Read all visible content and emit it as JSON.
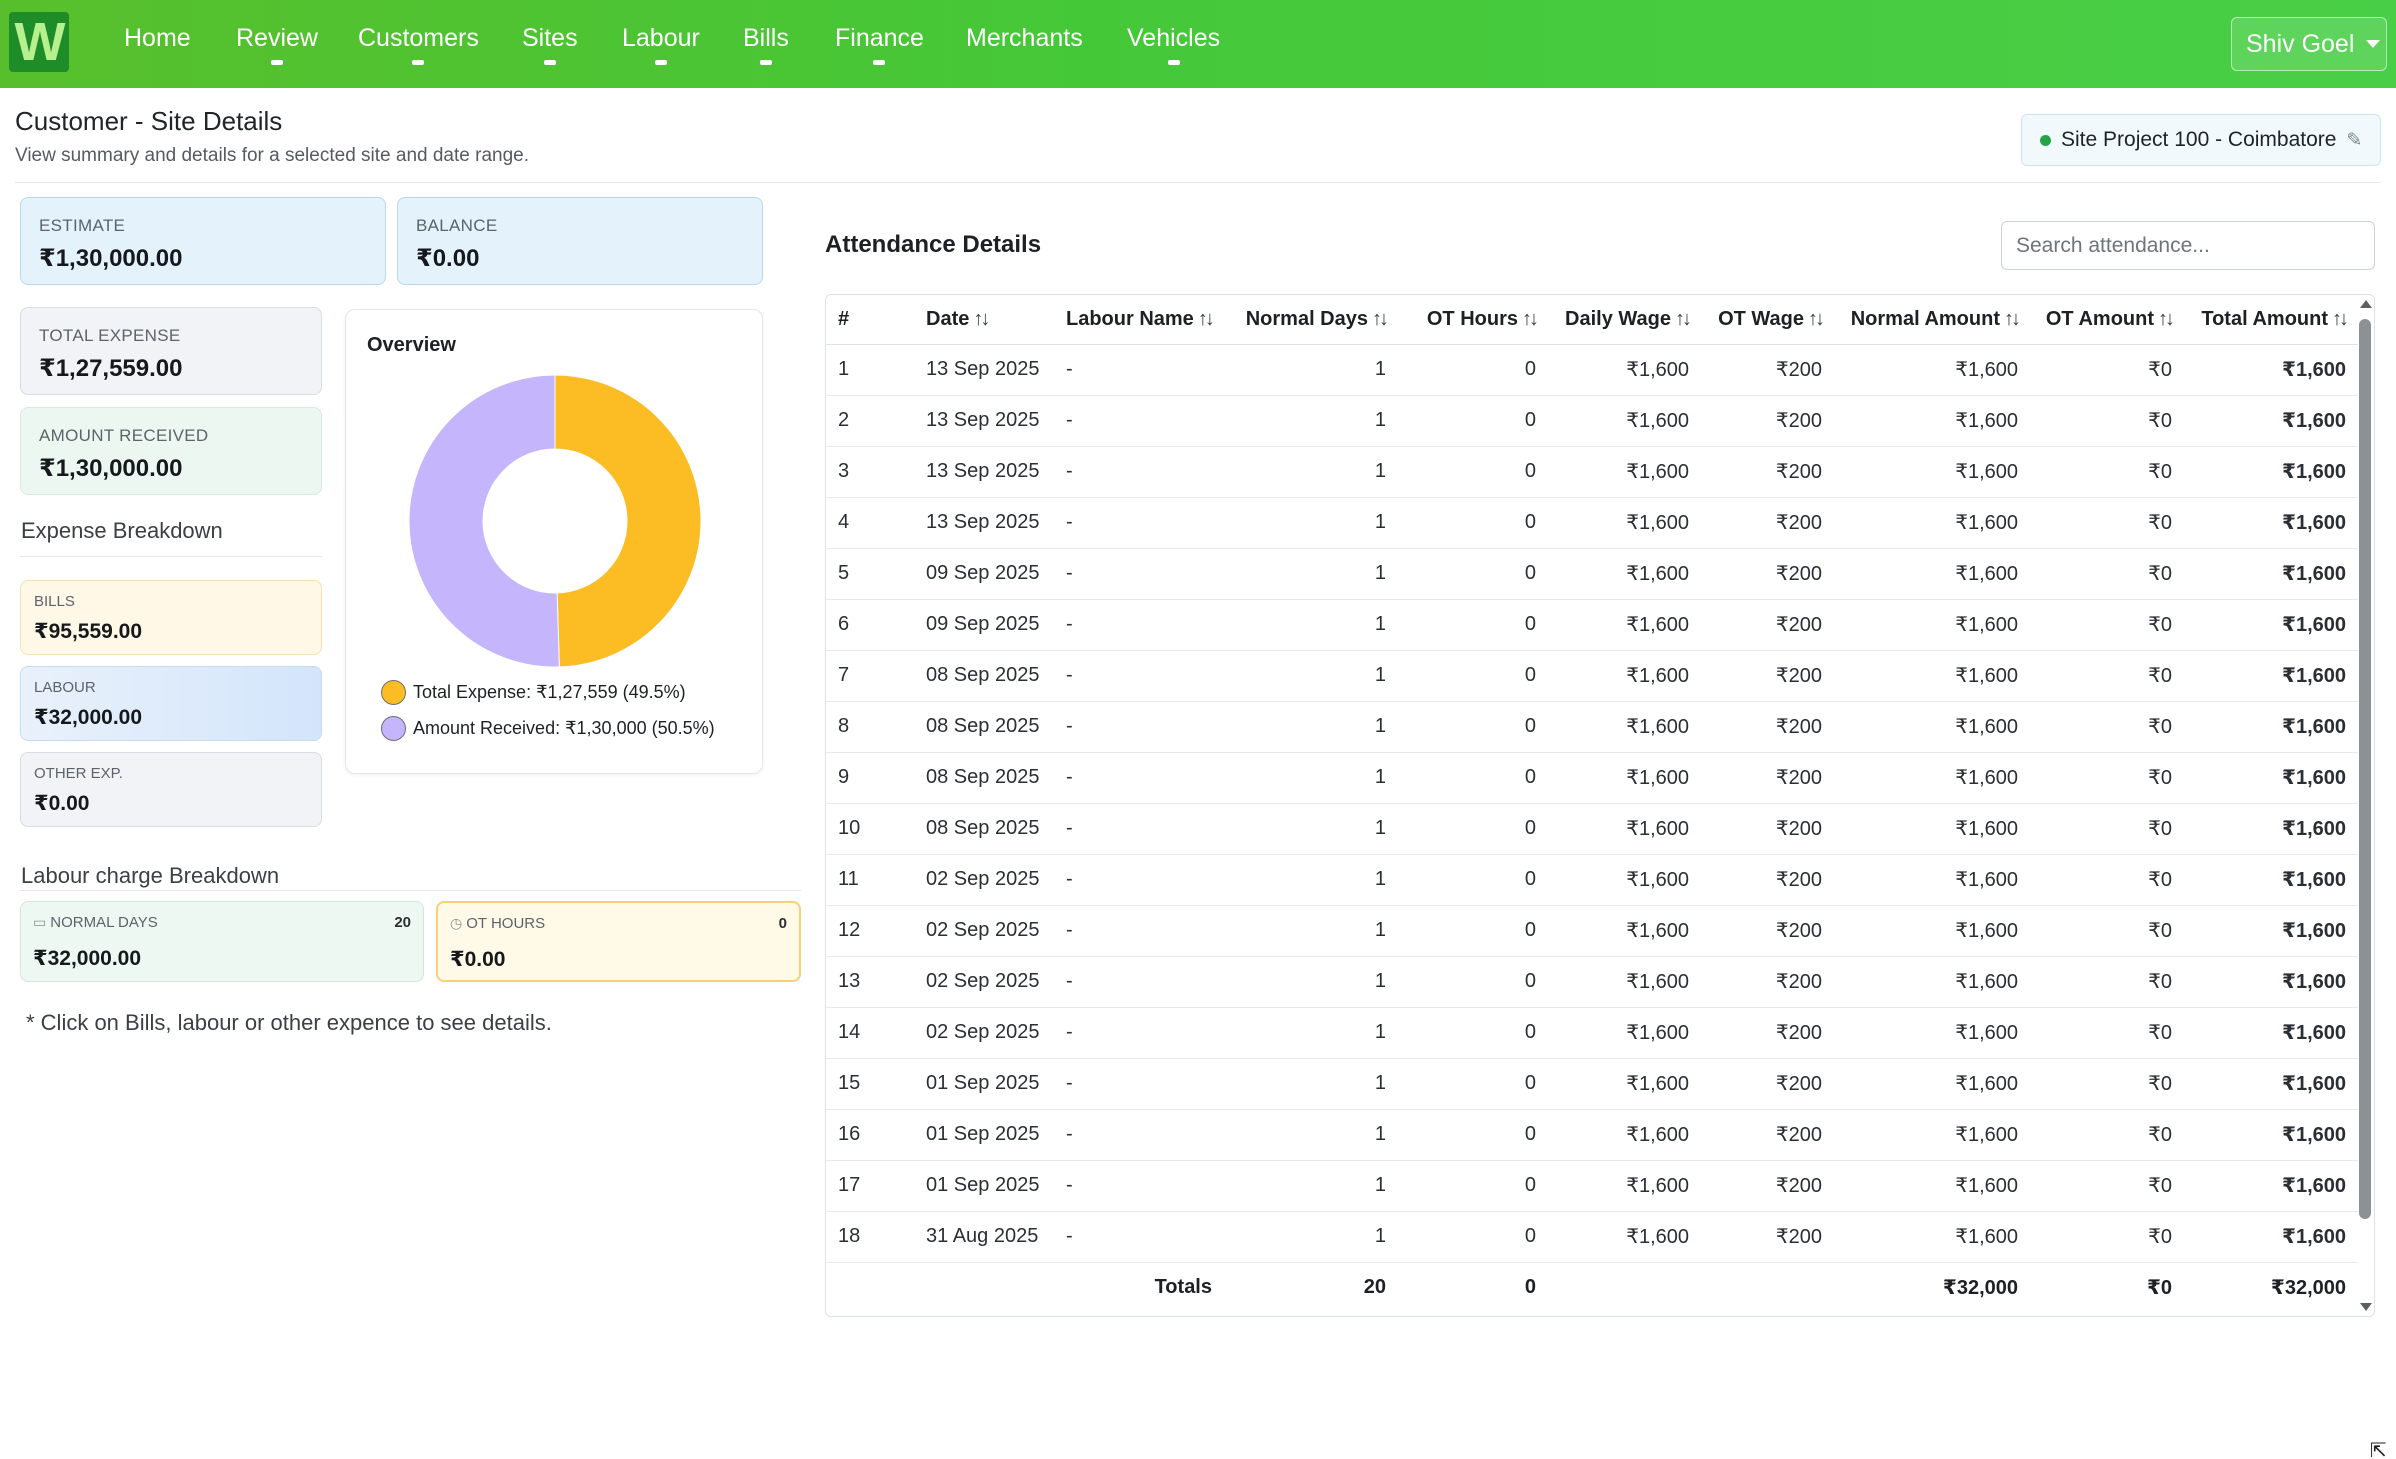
{
  "app": {
    "logo_letter": "W"
  },
  "nav": {
    "items": [
      {
        "label": "Home"
      },
      {
        "label": "Review"
      },
      {
        "label": "Customers"
      },
      {
        "label": "Sites"
      },
      {
        "label": "Labour"
      },
      {
        "label": "Bills"
      },
      {
        "label": "Finance"
      },
      {
        "label": "Merchants"
      },
      {
        "label": "Vehicles"
      }
    ],
    "user": "Shiv Goel"
  },
  "header": {
    "title": "Customer - Site Details",
    "subtitle": "View summary and details for a selected site and date range.",
    "site": "Site Project 100 - Coimbatore"
  },
  "summary": {
    "estimate": {
      "label": "ESTIMATE",
      "value": "₹1,30,000.00"
    },
    "balance": {
      "label": "BALANCE",
      "value": "₹0.00"
    },
    "total_expense": {
      "label": "TOTAL EXPENSE",
      "value": "₹1,27,559.00"
    },
    "amount_received": {
      "label": "AMOUNT RECEIVED",
      "value": "₹1,30,000.00"
    }
  },
  "expense_breakdown": {
    "title": "Expense Breakdown",
    "bills": {
      "label": "BILLS",
      "value": "₹95,559.00"
    },
    "labour": {
      "label": "LABOUR",
      "value": "₹32,000.00"
    },
    "other": {
      "label": "OTHER EXP.",
      "value": "₹0.00"
    }
  },
  "overview": {
    "title": "Overview",
    "legend": [
      {
        "label": "Total Expense: ₹1,27,559 (49.5%)",
        "color": "#fbbd23"
      },
      {
        "label": "Amount Received: ₹1,30,000 (50.5%)",
        "color": "#c4b5fd"
      }
    ]
  },
  "chart_data": {
    "type": "pie",
    "subtype": "donut",
    "title": "Overview",
    "slices": [
      {
        "name": "Total Expense",
        "value": 127559,
        "percent": 49.5,
        "color": "#fbbd23"
      },
      {
        "name": "Amount Received",
        "value": 130000,
        "percent": 50.5,
        "color": "#c4b5fd"
      }
    ],
    "legend_position": "bottom"
  },
  "labour_breakdown": {
    "title": "Labour charge Breakdown",
    "normal_days": {
      "label": "NORMAL DAYS",
      "count": "20",
      "value": "₹32,000.00"
    },
    "ot_hours": {
      "label": "OT HOURS",
      "count": "0",
      "value": "₹0.00"
    }
  },
  "footnote": "* Click on Bills, labour or other expence to see details.",
  "attendance": {
    "title": "Attendance Details",
    "search_placeholder": "Search attendance...",
    "columns": [
      "#",
      "Date",
      "Labour Name",
      "Normal Days",
      "OT Hours",
      "Daily Wage",
      "OT Wage",
      "Normal Amount",
      "OT Amount",
      "Total Amount"
    ],
    "rows": [
      [
        "1",
        "13 Sep 2025",
        "-",
        "1",
        "0",
        "₹1,600",
        "₹200",
        "₹1,600",
        "₹0",
        "₹1,600"
      ],
      [
        "2",
        "13 Sep 2025",
        "-",
        "1",
        "0",
        "₹1,600",
        "₹200",
        "₹1,600",
        "₹0",
        "₹1,600"
      ],
      [
        "3",
        "13 Sep 2025",
        "-",
        "1",
        "0",
        "₹1,600",
        "₹200",
        "₹1,600",
        "₹0",
        "₹1,600"
      ],
      [
        "4",
        "13 Sep 2025",
        "-",
        "1",
        "0",
        "₹1,600",
        "₹200",
        "₹1,600",
        "₹0",
        "₹1,600"
      ],
      [
        "5",
        "09 Sep 2025",
        "-",
        "1",
        "0",
        "₹1,600",
        "₹200",
        "₹1,600",
        "₹0",
        "₹1,600"
      ],
      [
        "6",
        "09 Sep 2025",
        "-",
        "1",
        "0",
        "₹1,600",
        "₹200",
        "₹1,600",
        "₹0",
        "₹1,600"
      ],
      [
        "7",
        "08 Sep 2025",
        "-",
        "1",
        "0",
        "₹1,600",
        "₹200",
        "₹1,600",
        "₹0",
        "₹1,600"
      ],
      [
        "8",
        "08 Sep 2025",
        "-",
        "1",
        "0",
        "₹1,600",
        "₹200",
        "₹1,600",
        "₹0",
        "₹1,600"
      ],
      [
        "9",
        "08 Sep 2025",
        "-",
        "1",
        "0",
        "₹1,600",
        "₹200",
        "₹1,600",
        "₹0",
        "₹1,600"
      ],
      [
        "10",
        "08 Sep 2025",
        "-",
        "1",
        "0",
        "₹1,600",
        "₹200",
        "₹1,600",
        "₹0",
        "₹1,600"
      ],
      [
        "11",
        "02 Sep 2025",
        "-",
        "1",
        "0",
        "₹1,600",
        "₹200",
        "₹1,600",
        "₹0",
        "₹1,600"
      ],
      [
        "12",
        "02 Sep 2025",
        "-",
        "1",
        "0",
        "₹1,600",
        "₹200",
        "₹1,600",
        "₹0",
        "₹1,600"
      ],
      [
        "13",
        "02 Sep 2025",
        "-",
        "1",
        "0",
        "₹1,600",
        "₹200",
        "₹1,600",
        "₹0",
        "₹1,600"
      ],
      [
        "14",
        "02 Sep 2025",
        "-",
        "1",
        "0",
        "₹1,600",
        "₹200",
        "₹1,600",
        "₹0",
        "₹1,600"
      ],
      [
        "15",
        "01 Sep 2025",
        "-",
        "1",
        "0",
        "₹1,600",
        "₹200",
        "₹1,600",
        "₹0",
        "₹1,600"
      ],
      [
        "16",
        "01 Sep 2025",
        "-",
        "1",
        "0",
        "₹1,600",
        "₹200",
        "₹1,600",
        "₹0",
        "₹1,600"
      ],
      [
        "17",
        "01 Sep 2025",
        "-",
        "1",
        "0",
        "₹1,600",
        "₹200",
        "₹1,600",
        "₹0",
        "₹1,600"
      ],
      [
        "18",
        "31 Aug 2025",
        "-",
        "1",
        "0",
        "₹1,600",
        "₹200",
        "₹1,600",
        "₹0",
        "₹1,600"
      ]
    ],
    "totals": {
      "label": "Totals",
      "normal_days": "20",
      "ot_hours": "0",
      "normal_amount": "₹32,000",
      "ot_amount": "₹0",
      "total_amount": "₹32,000"
    }
  }
}
